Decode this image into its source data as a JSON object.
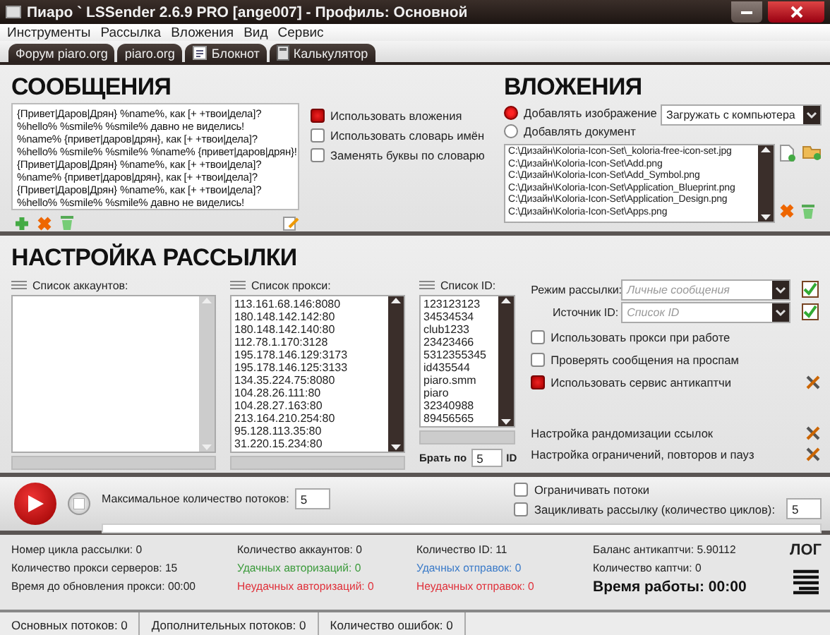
{
  "window": {
    "title": "Пиаро ` LSSender 2.6.9 PRO [ange007] - Профиль: Основной"
  },
  "menu": [
    "Инструменты",
    "Рассылка",
    "Вложения",
    "Вид",
    "Сервис"
  ],
  "toolbar": [
    {
      "label": "Форум piaro.org",
      "kind": "link"
    },
    {
      "label": "piaro.org",
      "kind": "link"
    },
    {
      "label": "Блокнот",
      "kind": "notepad"
    },
    {
      "label": "Калькулятор",
      "kind": "calculator"
    }
  ],
  "messages": {
    "title": "СООБЩЕНИЯ",
    "text": [
      "{Привет|Даров|Дрян} %name%, как [+ +твои|дела]?",
      "%hello% %smile% %smile% давно не виделись!",
      "%name% {привет|даров|дрян}, как [+ +твои|дела]?",
      "%hello% %smile% %smile% %name% {привет|даров|дрян}!",
      "{Привет|Даров|Дрян} %name%, как [+ +твои|дела]?",
      "%name% {привет|даров|дрян}, как [+ +твои|дела]?",
      "{Привет|Даров|Дрян} %name%, как [+ +твои|дела]?",
      "%hello% %smile% %smile% давно не виделись!"
    ],
    "options": [
      {
        "label": "Использовать вложения",
        "checked": true
      },
      {
        "label": "Использовать словарь имён",
        "checked": false
      },
      {
        "label": "Заменять буквы по словарю",
        "checked": false
      }
    ]
  },
  "attachments": {
    "title": "ВЛОЖЕНИЯ",
    "radios": [
      {
        "label": "Добавлять изображение",
        "selected": true
      },
      {
        "label": "Добавлять документ",
        "selected": false
      }
    ],
    "source": "Загружать с компьютера",
    "files": [
      "C:\\Дизайн\\Koloria-Icon-Set\\_koloria-free-icon-set.jpg",
      "C:\\Дизайн\\Koloria-Icon-Set\\Add.png",
      "C:\\Дизайн\\Koloria-Icon-Set\\Add_Symbol.png",
      "C:\\Дизайн\\Koloria-Icon-Set\\Application_Blueprint.png",
      "C:\\Дизайн\\Koloria-Icon-Set\\Application_Design.png",
      "C:\\Дизайн\\Koloria-Icon-Set\\Apps.png"
    ]
  },
  "settings": {
    "title": "НАСТРОЙКА РАССЫЛКИ",
    "accounts": {
      "label": "Список аккаунтов:"
    },
    "proxies": {
      "label": "Список прокси:",
      "items": [
        "113.161.68.146:8080",
        "180.148.142.142:80",
        "180.148.142.140:80",
        "112.78.1.170:3128",
        "195.178.146.129:3173",
        "195.178.146.125:3133",
        "134.35.224.75:8080",
        "104.28.26.111:80",
        "104.28.27.163:80",
        "213.164.210.254:80",
        "95.128.113.35:80",
        "31.220.15.234:80"
      ]
    },
    "ids": {
      "label": "Список ID:",
      "items": [
        "123123123",
        "34534534",
        "club1233",
        "23423466",
        "5312355345",
        "id435544",
        "piaro.smm",
        "piaro",
        "32340988",
        "89456565"
      ]
    },
    "take_by": {
      "label": "Брать по",
      "value": "5",
      "unit": "ID"
    },
    "mode": {
      "label": "Режим рассылки:",
      "placeholder": "Личные сообщения"
    },
    "source": {
      "label": "Источник ID:",
      "placeholder": "Список ID"
    },
    "options": [
      {
        "label": "Использовать прокси при работе",
        "checked": false
      },
      {
        "label": "Проверять сообщения на проспам",
        "checked": false
      },
      {
        "label": "Использовать сервис антикаптчи",
        "checked": true
      }
    ],
    "links": [
      "Настройка рандомизации ссылок",
      "Настройка ограничений, повторов и пауз"
    ]
  },
  "controls": {
    "threads": {
      "label": "Максимальное количество потоков:",
      "value": "5"
    },
    "limit": {
      "label": "Ограничивать потоки",
      "checked": false
    },
    "loop": {
      "label": "Зацикливать рассылку (количество циклов):",
      "checked": false,
      "value": "5"
    },
    "progress": {
      "level": 0
    }
  },
  "stats": [
    [
      {
        "text": "Номер цикла рассылки: 0",
        "kind": "plain"
      },
      {
        "text": "Количество прокси серверов: 15",
        "kind": "plain"
      },
      {
        "text": "Время до обновления прокси: 00:00",
        "kind": "plain"
      }
    ],
    [
      {
        "text": "Количество аккаунтов: 0",
        "kind": "plain"
      },
      {
        "text": "Удачных авторизаций: 0",
        "kind": "success"
      },
      {
        "text": "Неудачных авторизаций: 0",
        "kind": "failure"
      }
    ],
    [
      {
        "text": "Количество ID: 11",
        "kind": "plain"
      },
      {
        "text": "Удачных отправок: 0",
        "kind": "sent"
      },
      {
        "text": "Неудачных отправок: 0",
        "kind": "failure"
      }
    ],
    [
      {
        "text": "Баланс антикаптчи: 5.90112",
        "kind": "plain"
      },
      {
        "text": "Количество каптчи: 0",
        "kind": "plain"
      },
      {
        "text": "Время работы: 00:00",
        "kind": "total"
      }
    ]
  ],
  "log": "ЛОГ",
  "status_bar": [
    "Основных потоков: 0",
    "Дополнительных потоков: 0",
    "Количество ошибок: 0"
  ]
}
